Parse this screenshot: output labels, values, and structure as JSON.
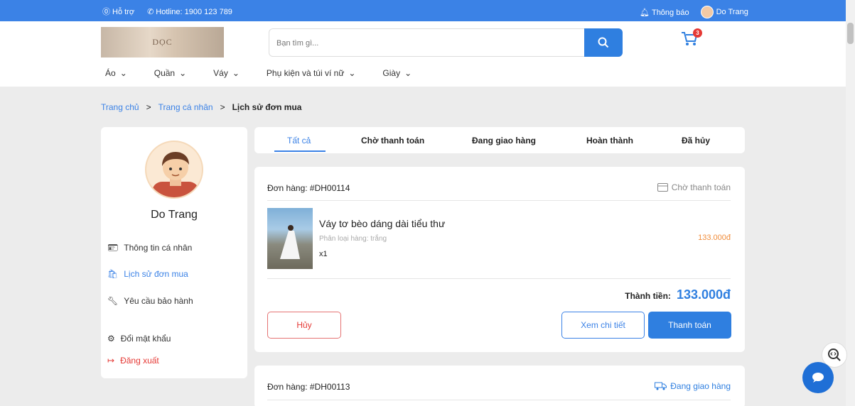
{
  "topbar": {
    "support": "Hỗ trợ",
    "hotline": "Hotline: 1900 123 789",
    "notifications": "Thông báo",
    "user": "Do Trang"
  },
  "header": {
    "logo_text": "DỌC",
    "search_placeholder": "Bạn tìm gì...",
    "cart_count": "3"
  },
  "nav": {
    "items": [
      {
        "label": "Áo"
      },
      {
        "label": "Quần"
      },
      {
        "label": "Váy"
      },
      {
        "label": "Phụ kiện và túi ví nữ"
      },
      {
        "label": "Giày"
      }
    ]
  },
  "breadcrumb": {
    "home": "Trang chủ",
    "profile": "Trang cá nhân",
    "current": "Lịch sử đơn mua",
    "sep": ">"
  },
  "sidebar": {
    "name": "Do Trang",
    "items": [
      {
        "label": "Thông tin cá nhân"
      },
      {
        "label": "Lịch sử đơn mua"
      },
      {
        "label": "Yêu cầu bảo hành"
      },
      {
        "label": "Đổi mật khẩu"
      },
      {
        "label": "Đăng xuất"
      }
    ]
  },
  "tabs": [
    {
      "label": "Tất cả"
    },
    {
      "label": "Chờ thanh toán"
    },
    {
      "label": "Đang giao hàng"
    },
    {
      "label": "Hoàn thành"
    },
    {
      "label": "Đã hủy"
    }
  ],
  "orders": [
    {
      "label": "Đơn hàng:",
      "code": "#DH00114",
      "status": "Chờ thanh toán",
      "product": {
        "name": "Váy tơ bèo dáng dài tiểu thư",
        "variant": "Phân loại hàng: trắng",
        "qty": "x1",
        "price": "133.000đ"
      },
      "total_label": "Thành tiền:",
      "total": "133.000đ",
      "actions": {
        "cancel": "Hủy",
        "detail": "Xem chi tiết",
        "pay": "Thanh toán"
      }
    },
    {
      "label": "Đơn hàng:",
      "code": "#DH00113",
      "status": "Đang giao hàng"
    }
  ],
  "colors": {
    "primary": "#3b82e6",
    "danger": "#e53935",
    "price": "#f08c3a"
  }
}
